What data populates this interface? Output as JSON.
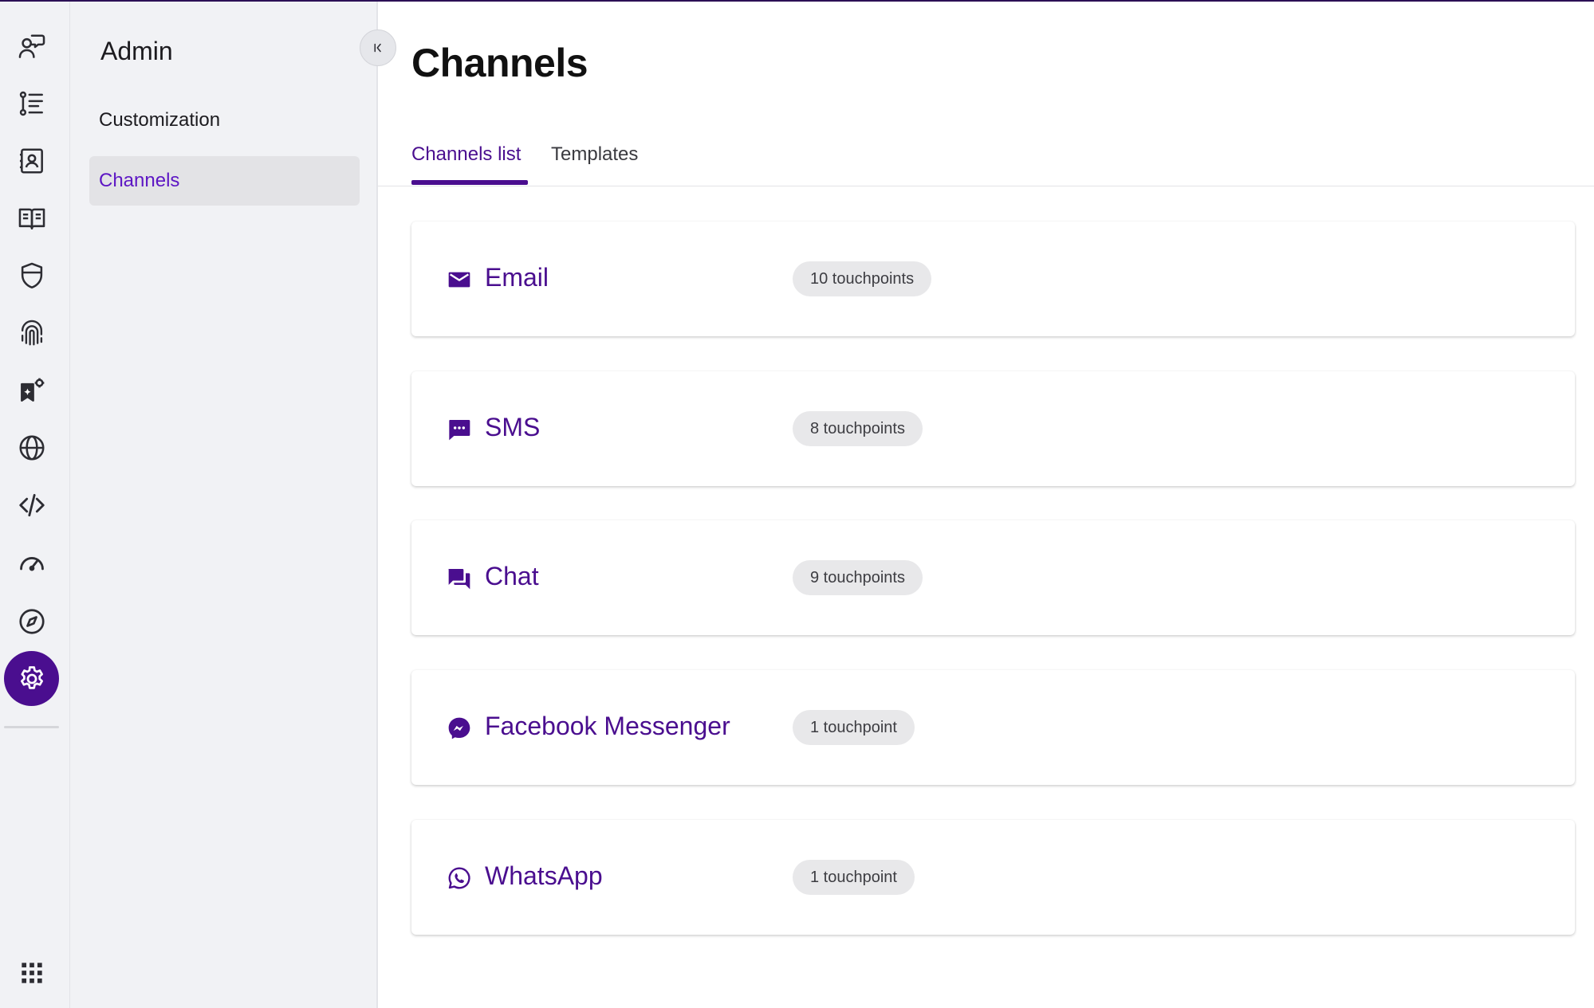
{
  "rail": {
    "items": [
      {
        "name": "conversations-icon"
      },
      {
        "name": "journeys-icon"
      },
      {
        "name": "contacts-icon"
      },
      {
        "name": "knowledge-icon"
      },
      {
        "name": "security-icon"
      },
      {
        "name": "identity-icon"
      },
      {
        "name": "ai-settings-icon"
      },
      {
        "name": "web-icon"
      },
      {
        "name": "developer-icon"
      },
      {
        "name": "performance-icon"
      },
      {
        "name": "explore-icon"
      },
      {
        "name": "settings-icon",
        "active": true
      }
    ],
    "apps": "apps-grid-icon"
  },
  "panel": {
    "title": "Admin",
    "items": [
      {
        "label": "Customization"
      },
      {
        "label": "Channels",
        "selected": true
      }
    ]
  },
  "main": {
    "title": "Channels",
    "tabs": [
      {
        "label": "Channels list",
        "active": true
      },
      {
        "label": "Templates"
      }
    ],
    "channels": [
      {
        "name": "Email",
        "touchpoints": "10 touchpoints",
        "icon": "mail-icon"
      },
      {
        "name": "SMS",
        "touchpoints": "8 touchpoints",
        "icon": "sms-icon"
      },
      {
        "name": "Chat",
        "touchpoints": "9 touchpoints",
        "icon": "chat-icon"
      },
      {
        "name": "Facebook Messenger",
        "touchpoints": "1 touchpoint",
        "icon": "messenger-icon"
      },
      {
        "name": "WhatsApp",
        "touchpoints": "1 touchpoint",
        "icon": "whatsapp-icon"
      }
    ]
  },
  "colors": {
    "accent": "#4a0e8f",
    "selected_text": "#5d16c4",
    "rail_bg": "#f1f2f5",
    "badge_bg": "#e8e8ea"
  }
}
